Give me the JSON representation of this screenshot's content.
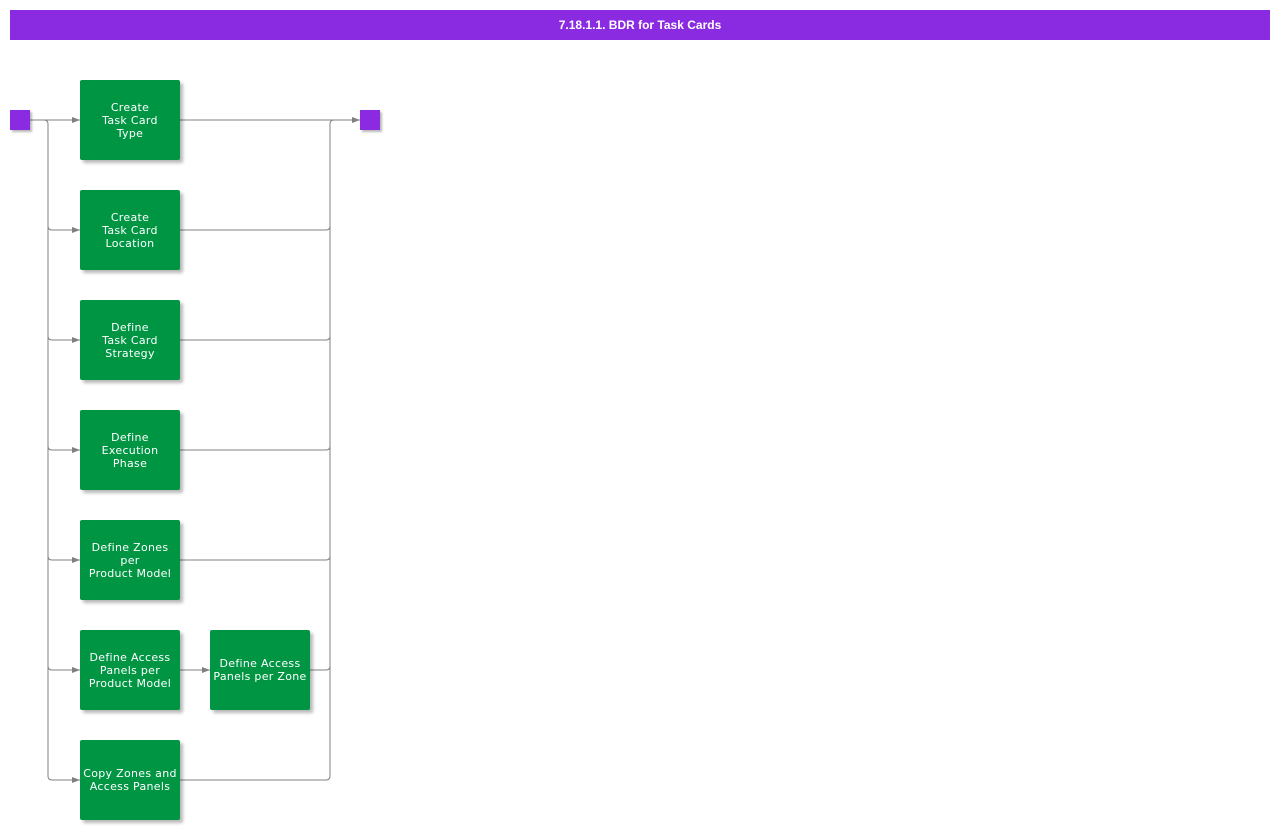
{
  "header": {
    "title": "7.18.1.1. BDR for Task Cards"
  },
  "colors": {
    "header_bg": "#8a2be2",
    "endpoint": "#8a2be2",
    "node_bg": "#009543",
    "node_text": "#ffffff",
    "connector": "#808080"
  },
  "diagram": {
    "start_label": "",
    "end_label": "",
    "nodes": [
      {
        "id": "create-task-card-type",
        "label": "Create\nTask Card\nType"
      },
      {
        "id": "create-task-card-location",
        "label": "Create\nTask Card\nLocation"
      },
      {
        "id": "define-task-card-strategy",
        "label": "Define\nTask Card\nStrategy"
      },
      {
        "id": "define-execution-phase",
        "label": "Define Execution\nPhase"
      },
      {
        "id": "define-zones-per-product-model",
        "label": "Define Zones per\nProduct Model"
      },
      {
        "id": "define-access-panels-per-product-model",
        "label": "Define Access\nPanels per\nProduct Model"
      },
      {
        "id": "define-access-panels-per-zone",
        "label": "Define Access\nPanels per Zone"
      },
      {
        "id": "copy-zones-and-access-panels",
        "label": "Copy Zones and\nAccess Panels"
      }
    ],
    "edges": [
      {
        "from": "start",
        "to": "create-task-card-type"
      },
      {
        "from": "start",
        "to": "create-task-card-location"
      },
      {
        "from": "start",
        "to": "define-task-card-strategy"
      },
      {
        "from": "start",
        "to": "define-execution-phase"
      },
      {
        "from": "start",
        "to": "define-zones-per-product-model"
      },
      {
        "from": "start",
        "to": "define-access-panels-per-product-model"
      },
      {
        "from": "start",
        "to": "copy-zones-and-access-panels"
      },
      {
        "from": "define-access-panels-per-product-model",
        "to": "define-access-panels-per-zone"
      },
      {
        "from": "create-task-card-type",
        "to": "end"
      },
      {
        "from": "create-task-card-location",
        "to": "end"
      },
      {
        "from": "define-task-card-strategy",
        "to": "end"
      },
      {
        "from": "define-execution-phase",
        "to": "end"
      },
      {
        "from": "define-zones-per-product-model",
        "to": "end"
      },
      {
        "from": "define-access-panels-per-zone",
        "to": "end"
      },
      {
        "from": "copy-zones-and-access-panels",
        "to": "end"
      }
    ]
  }
}
